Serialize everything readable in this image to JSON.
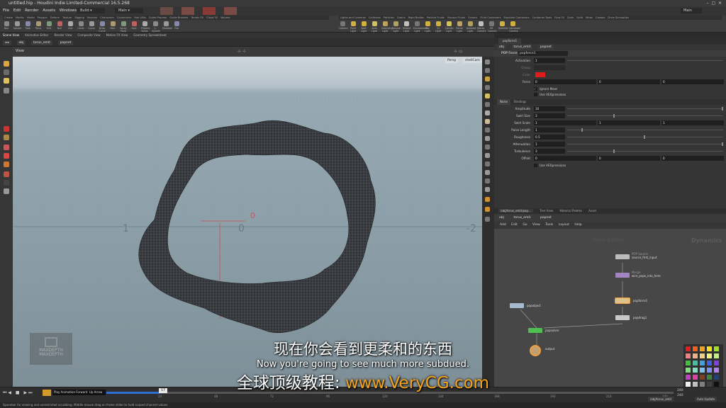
{
  "window": {
    "title": "untitled.hip - Houdini Indie Limited-Commercial 16.5.268"
  },
  "menu": [
    "File",
    "Edit",
    "Render",
    "Assets",
    "Windows",
    "Help"
  ],
  "desktop": {
    "label": "Build",
    "main_label": "Main",
    "right_desktop": "Main"
  },
  "shelf": {
    "tabs_left": [
      "Create",
      "Modify",
      "Model",
      "Polygon",
      "Deform",
      "Texture",
      "Rigging",
      "Muscles",
      "Characters",
      "Constraints",
      "Hair Utils",
      "Guide Process",
      "Guide Brushes",
      "Terrain FX",
      "Cloud FX",
      "Volume"
    ],
    "tools_left": [
      "Box",
      "Sphere",
      "Tube",
      "Torus",
      "Grid",
      "Null",
      "Line",
      "Circle",
      "Curve",
      "Draw Curve",
      "Path",
      "Spray Paint",
      "Font",
      "Platonic Solids",
      "L-System",
      "Metaball",
      "File"
    ],
    "tabs_right": [
      "Lights and Cameras",
      "Collisions",
      "Particles",
      "Grains",
      "Rigid Bodies",
      "Particle Fluids",
      "Viscous Fluids",
      "Oceans",
      "Fluid Containers",
      "Populate Containers",
      "Container Tools",
      "Pyro FX",
      "Cloth",
      "Solid",
      "Wires",
      "Crowds",
      "Drive Simulation"
    ],
    "tools_right": [
      "Camera",
      "Point Light",
      "Spot Light",
      "Area Light",
      "Geometry Light",
      "Volume Light",
      "Distant Light",
      "Environment Light",
      "Sky Light",
      "GI Light",
      "Caustic Light",
      "Portal Light",
      "Ambient Light",
      "Stereo Camera",
      "VR Camera",
      "Switcher",
      "Gamepad Camera"
    ]
  },
  "pane_tabs": [
    "Scene View",
    "Animation Editor",
    "Render View",
    "Composite View",
    "Motion FX View",
    "Geometry Spreadsheet"
  ],
  "path": {
    "obj": "obj",
    "node": "torus_emit",
    "sub": "popnet"
  },
  "viewport": {
    "label": "View",
    "persp": "Persp",
    "cam": "shellCam",
    "axis_labels": [
      "1",
      "0",
      "-2",
      "0"
    ]
  },
  "params": {
    "tab": "popforce1",
    "node_type": "POP Force",
    "node_name": "popforce1",
    "path": {
      "obj": "obj",
      "node": "torus_emit",
      "sub": "popnet"
    },
    "rows_top": [
      {
        "label": "Activation",
        "value": "1"
      },
      {
        "label": "Group",
        "value": ""
      },
      {
        "label": "Color",
        "value": ""
      },
      {
        "label": "Force",
        "value": "0"
      }
    ],
    "force_values": [
      "0",
      "0",
      "0"
    ],
    "ignore_mass": "Ignore Mass",
    "use_vex": "Use VEXpressions",
    "subtabs": [
      "Noise",
      "Bindings"
    ],
    "noise_rows": [
      {
        "label": "Amplitude",
        "value": "10"
      },
      {
        "label": "Swirl Size",
        "value": "3"
      },
      {
        "label": "Swirl Scale",
        "value": "1"
      },
      {
        "label": "Pulse Length",
        "value": "1"
      },
      {
        "label": "Roughness",
        "value": "0.5"
      },
      {
        "label": "Attenuation",
        "value": "1"
      },
      {
        "label": "Turbulence",
        "value": "3"
      },
      {
        "label": "Offset",
        "value": "0"
      }
    ],
    "swirl_scale_extra": [
      "1",
      "1"
    ],
    "offset_extra": [
      "0",
      "0"
    ],
    "use_vex2": "Use VEXpressions"
  },
  "network": {
    "tabs": [
      "/obj/torus_emit/pop...",
      "Tree View",
      "Material Palette",
      "Asset"
    ],
    "path": {
      "obj": "obj",
      "node": "torus_emit",
      "sub": "popnet"
    },
    "menu": [
      "Add",
      "Edit",
      "Go",
      "View",
      "Tools",
      "Layout",
      "Help"
    ],
    "watermark": "Indie Edition",
    "context": "Dynamics",
    "nodes": [
      {
        "type": "POP Source",
        "name": "source_first_input"
      },
      {
        "type": "Merge",
        "name": "wire_pops_into_here"
      },
      {
        "type": "",
        "name": "popforce1"
      },
      {
        "type": "",
        "name": "popdrag1"
      },
      {
        "type": "",
        "name": "popobject"
      },
      {
        "type": "",
        "name": "popsolver"
      },
      {
        "type": "",
        "name": "output"
      }
    ]
  },
  "timeline": {
    "frame": "17",
    "tooltip": "Play Animation Forward",
    "tooltip_key": "Up Arrow",
    "ticks": [
      "24",
      "48",
      "72",
      "96",
      "120",
      "144",
      "168",
      "192",
      "216",
      "240"
    ],
    "end_a": "240",
    "end_b": "240",
    "start": "1",
    "status_path": "/obj/torus_emit",
    "auto_update": "Auto Update"
  },
  "status": "Spacebar for viewing and unrestricted scrubbing. Middle mouse drag on frame slider to hold scoped channel values.",
  "subtitles": {
    "zh": "现在你会看到更柔和的东西",
    "en": "Now you're going to see much more subdued.",
    "ad_prefix": "全球顶级教程: ",
    "ad_url": "www.VeryCG.com"
  },
  "logo_text": [
    "MAXDEPTH",
    "MAXDEPTH"
  ],
  "colors": {
    "accent": "#f3a31c",
    "color_swatch": "#e01b1b",
    "node_solver": "#4fbf4f",
    "node_force": "#f0a040"
  }
}
